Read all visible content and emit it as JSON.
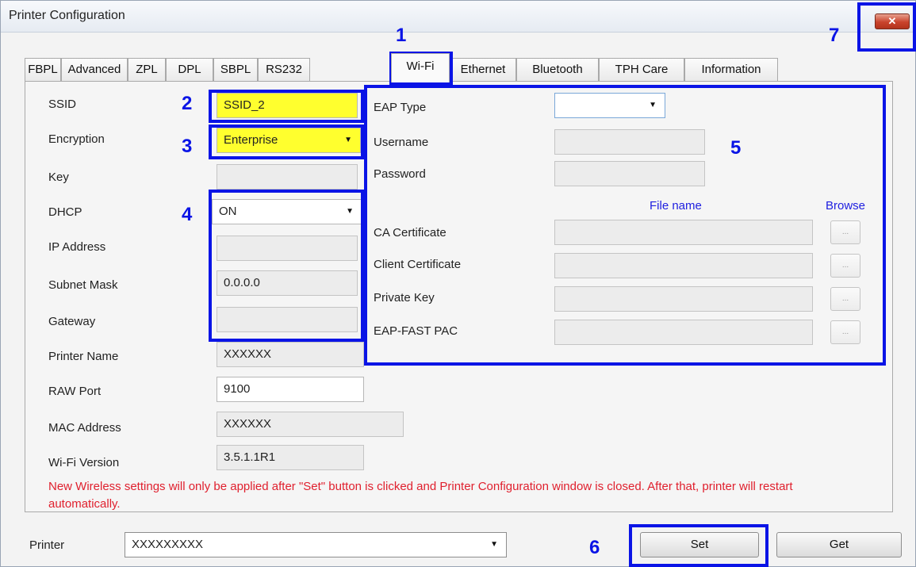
{
  "window": {
    "title": "Printer Configuration",
    "close_label": "✕"
  },
  "tabs": [
    {
      "label": "FBPL"
    },
    {
      "label": "Advanced"
    },
    {
      "label": "ZPL"
    },
    {
      "label": "DPL"
    },
    {
      "label": "SBPL"
    },
    {
      "label": "RS232"
    },
    {
      "label": "Wi-Fi",
      "active": true
    },
    {
      "label": "Ethernet"
    },
    {
      "label": "Bluetooth"
    },
    {
      "label": "TPH Care"
    },
    {
      "label": "Information"
    }
  ],
  "network": {
    "ssid_label": "SSID",
    "ssid_value": "SSID_2",
    "encryption_label": "Encryption",
    "encryption_value": "Enterprise",
    "key_label": "Key",
    "key_value": "",
    "dhcp_label": "DHCP",
    "dhcp_value": "ON",
    "ip_label": "IP Address",
    "ip_value": "",
    "subnet_label": "Subnet Mask",
    "subnet_value": "0.0.0.0",
    "gateway_label": "Gateway",
    "gateway_value": "",
    "printer_name_label": "Printer Name",
    "printer_name_value": "XXXXXX",
    "raw_port_label": "RAW Port",
    "raw_port_value": "9100",
    "mac_label": "MAC Address",
    "mac_value": "XXXXXX",
    "wifi_version_label": "Wi-Fi Version",
    "wifi_version_value": "3.5.1.1R1"
  },
  "eap": {
    "eap_type_label": "EAP Type",
    "eap_type_value": "",
    "username_label": "Username",
    "username_value": "",
    "password_label": "Password",
    "password_value": "",
    "file_name_header": "File name",
    "browse_header": "Browse",
    "browse_button_label": "...",
    "certs": [
      {
        "label": "CA Certificate",
        "value": ""
      },
      {
        "label": "Client Certificate",
        "value": ""
      },
      {
        "label": "Private Key",
        "value": ""
      },
      {
        "label": "EAP-FAST PAC",
        "value": ""
      }
    ]
  },
  "notice": "New Wireless settings will only be applied after \"Set\" button is clicked and Printer Configuration window is closed. After that, printer will restart automatically.",
  "footer": {
    "printer_label": "Printer",
    "printer_value": "XXXXXXXXX",
    "set_label": "Set",
    "get_label": "Get"
  },
  "callouts": {
    "n1": "1",
    "n2": "2",
    "n3": "3",
    "n4": "4",
    "n5": "5",
    "n6": "6",
    "n7": "7"
  },
  "colors": {
    "callout": "#0a14e6",
    "highlight": "#ffff2e",
    "notice": "#e0202e",
    "header_link": "#2020e0"
  }
}
